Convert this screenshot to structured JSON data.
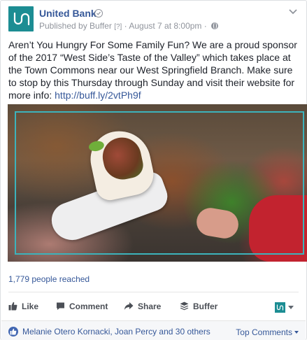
{
  "post": {
    "page_name": "United Bank",
    "published_by": "Published by Buffer",
    "help_marker": "[?]",
    "timestamp": "August 7 at 8:00pm",
    "separator": "·",
    "text": "Aren’t You Hungry For Some Family Fun? We are a proud sponsor of the 2017 “West Side’s Taste of the Valley” which takes place at the Town Commons near our West Springfield Branch. Make sure to stop by this Thursday through Sunday and visit their website for more info: ",
    "link": "http://buff.ly/2vtPh9f"
  },
  "stats": {
    "reach": "1,779 people reached"
  },
  "actions": {
    "like": "Like",
    "comment": "Comment",
    "share": "Share",
    "buffer": "Buffer"
  },
  "footer": {
    "likers": "Melanie Otero Kornacki, Joan Percy and 30 others",
    "top_comments": "Top Comments"
  },
  "colors": {
    "brand_teal": "#1c8d93",
    "link_blue": "#365899",
    "like_blue": "#4267b2"
  },
  "icons": [
    "verified-badge-icon",
    "globe-icon",
    "chevron-down-icon",
    "like-thumb-icon",
    "comment-icon",
    "share-icon",
    "buffer-stack-icon",
    "caret-down-icon"
  ]
}
